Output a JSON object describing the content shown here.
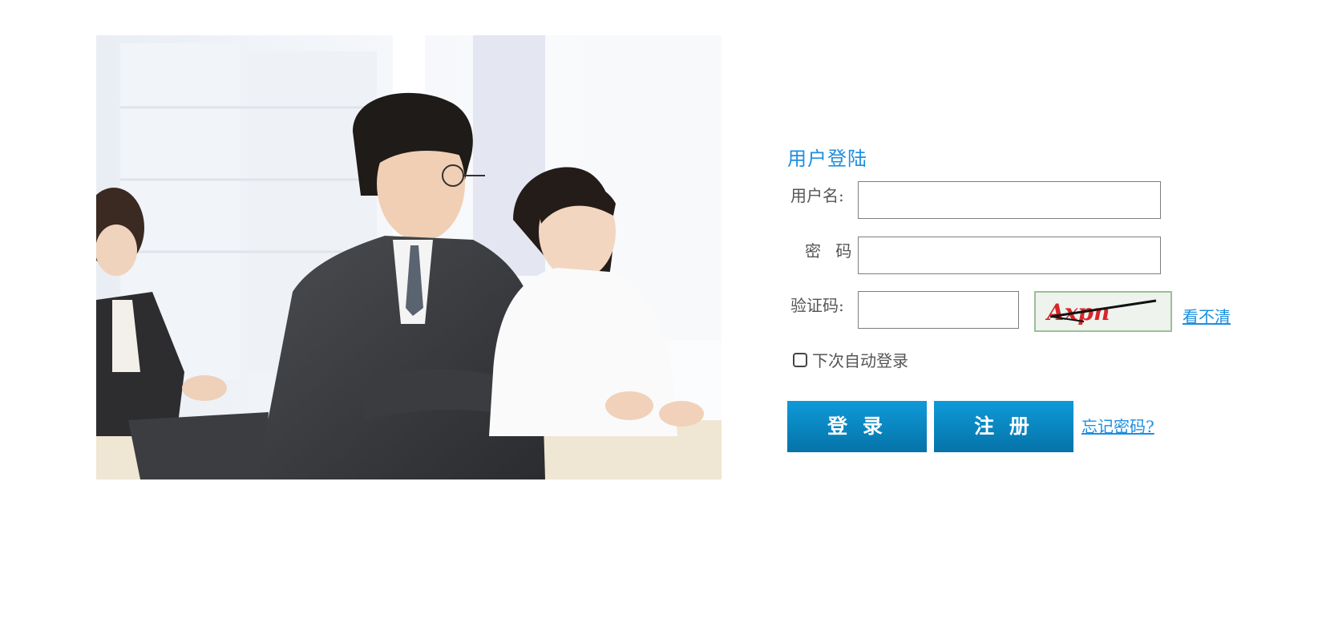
{
  "hero": {
    "description_icon": "office-meeting-photo"
  },
  "login": {
    "title": "用户登陆",
    "username_label": "用户名:",
    "username_value": "",
    "password_label": "密 码:",
    "password_value": "",
    "captcha_label": "验证码:",
    "captcha_value": "",
    "captcha_image_text": "Axpn",
    "refresh_link": "看不清",
    "remember_label": "下次自动登录",
    "remember_checked": false,
    "login_button": "登 录",
    "register_button": "注 册",
    "forgot_link": "忘记密码?"
  },
  "colors": {
    "accent": "#1d8fe0",
    "button_top": "#0f9ad9",
    "button_bottom": "#0573a8"
  }
}
